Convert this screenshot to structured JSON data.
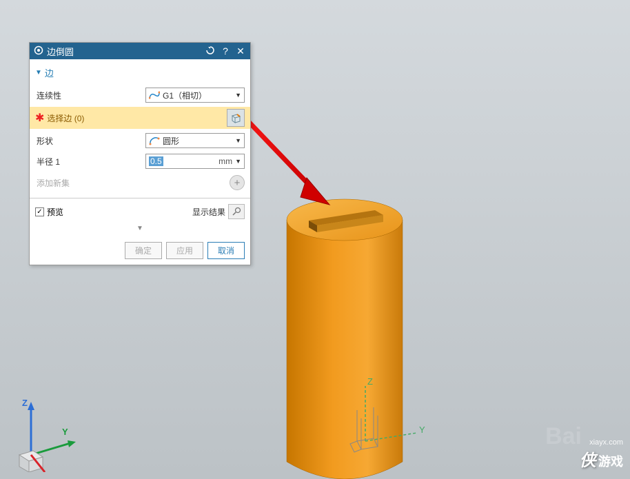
{
  "dialog": {
    "title": "边倒圆",
    "section_header": "边",
    "continuity": {
      "label": "连续性",
      "value": "G1（相切）"
    },
    "select_edge": {
      "label": "选择边 (0)"
    },
    "shape": {
      "label": "形状",
      "value": "圆形"
    },
    "radius": {
      "label": "半径 1",
      "value": "0.5",
      "unit": "mm"
    },
    "add_set": "添加新集",
    "preview": "预览",
    "show_result": "显示结果",
    "buttons": {
      "ok": "确定",
      "apply": "应用",
      "cancel": "取消"
    }
  },
  "axis": {
    "z": "Z",
    "y": "Y",
    "mini_z": "Z",
    "mini_y": "Y"
  },
  "watermark": {
    "url": "xiayx.com",
    "brand": "侠",
    "sub": "游戏",
    "bg": "Bai"
  }
}
